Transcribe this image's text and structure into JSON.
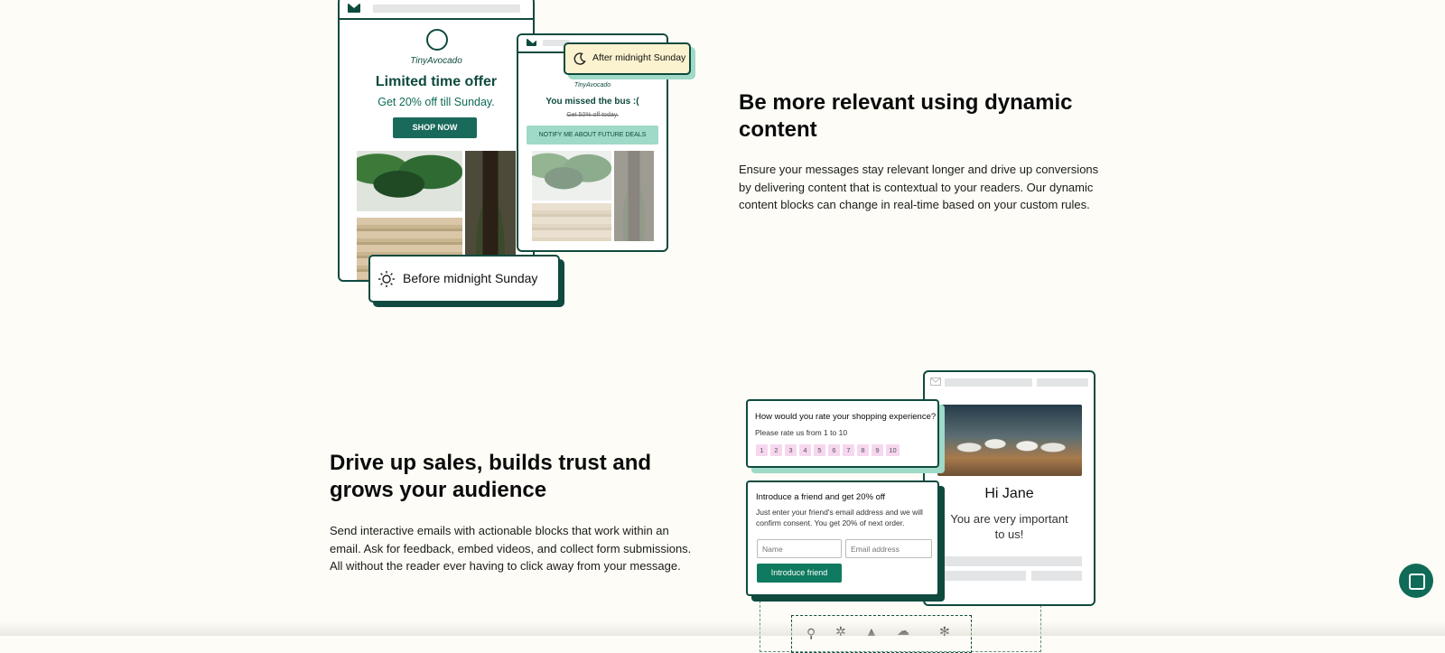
{
  "section1": {
    "email_a": {
      "brand": "TinyAvocado",
      "title": "Limited time offer",
      "subtitle": "Get 20% off till Sunday.",
      "cta": "SHOP NOW"
    },
    "email_b": {
      "brand": "TinyAvocado",
      "title": "You missed the bus :(",
      "subtitle": "Get 50% off today.",
      "cta": "NOTIFY ME ABOUT FUTURE DEALS"
    },
    "pill_after": {
      "label": "After midnight Sunday",
      "icon": "moon-icon"
    },
    "pill_before": {
      "label": "Before midnight Sunday",
      "icon": "sun-icon"
    },
    "heading": "Be more relevant using dynamic content",
    "body": "Ensure your messages stay relevant longer and drive up conversions by delivering content that is contextual to your readers. Our dynamic content blocks can change in real-time based on your custom rules."
  },
  "section2": {
    "heading": "Drive up sales, builds trust and grows your audience",
    "body": "Send interactive emails with actionable blocks that work within an email. Ask for feedback, embed videos, and collect form submissions. All without the reader ever having to click away from your message.",
    "survey": {
      "question": "How would you rate your shopping experience?",
      "hint": "Please rate us from 1 to 10",
      "ratings": [
        "1",
        "2",
        "3",
        "4",
        "5",
        "6",
        "7",
        "8",
        "9",
        "10"
      ]
    },
    "referral": {
      "title": "Introduce a friend and get 20% off",
      "text": "Just enter your friend's email address and we will confirm consent. You get 20% of next order.",
      "name_placeholder": "Name",
      "email_placeholder": "Email address",
      "button": "Introduce friend"
    },
    "greeting": {
      "name": "Hi Jane",
      "message": "You are very important to us!"
    }
  },
  "colors": {
    "brand_dark": "#0f4a3e",
    "brand_green": "#1a6a5b",
    "mint": "#9fd9c7",
    "background": "#fdfcf6"
  }
}
